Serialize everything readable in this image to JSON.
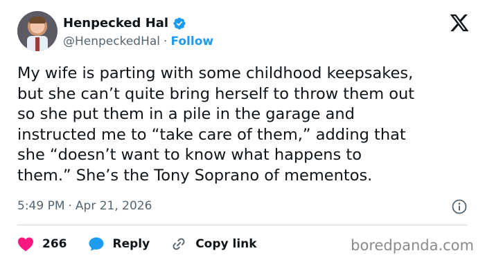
{
  "author": {
    "name": "Henpecked Hal",
    "handle": "@HenpeckedHal",
    "separator": "·",
    "follow_label": "Follow"
  },
  "post": {
    "lines": [
      "My wife is parting with some childhood keepsakes,",
      "but she can’t quite bring herself to throw them out",
      "so she put them in a pile in the garage and",
      "instructed me to “take care of them,” adding that",
      "she “doesn’t want to know what happens to",
      "them.” She’s the Tony Soprano of mementos."
    ]
  },
  "meta": {
    "time": "5:49 PM",
    "separator": "·",
    "date": "Apr 21, 2026"
  },
  "actions": {
    "likes_count": "266",
    "reply_label": "Reply",
    "copy_link_label": "Copy link"
  },
  "watermark": "boredpanda.com",
  "colors": {
    "accent": "#1d9bf0",
    "like": "#f91880",
    "text": "#0f1419",
    "secondary": "#536471"
  },
  "icons": [
    "verified-badge-icon",
    "x-logo-icon",
    "info-icon",
    "heart-icon",
    "reply-bubble-icon",
    "link-icon"
  ]
}
